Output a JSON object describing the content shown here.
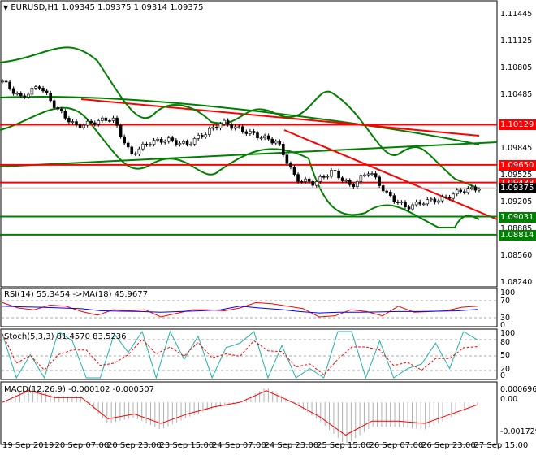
{
  "header": {
    "arrow": "▼",
    "symbol": "EURUSD,H1",
    "ohlc": "1.09345 1.09375 1.09314 1.09375"
  },
  "price_axis": [
    "1.11445",
    "1.11125",
    "1.10805",
    "1.10485",
    "1.09845",
    "1.09525",
    "1.09205",
    "1.08885",
    "1.08560",
    "1.08240"
  ],
  "levels": [
    {
      "value": 1.10129,
      "label": "1.10129",
      "color": "#ff0000"
    },
    {
      "value": 1.0965,
      "label": "1.09650",
      "color": "#ff0000"
    },
    {
      "value": 1.09438,
      "label": "1.09438",
      "color": "#ff0000"
    },
    {
      "value": 1.09375,
      "label": "1.09375",
      "color": "#000000"
    },
    {
      "value": 1.09031,
      "label": "1.09031",
      "color": "#008000"
    },
    {
      "value": 1.08814,
      "label": "1.08814",
      "color": "#008000"
    }
  ],
  "chart_data": {
    "type": "line",
    "closes": [
      1.1065,
      1.1045,
      1.106,
      1.1031,
      1.1011,
      1.1016,
      1.1021,
      1.0977,
      1.0992,
      1.0995,
      1.0989,
      1.1002,
      1.1016,
      1.1007,
      1.0999,
      1.0992,
      1.0948,
      1.0943,
      1.0958,
      1.0939,
      1.0958,
      1.0929,
      1.0914,
      1.0921,
      1.0924,
      1.0934,
      1.09375
    ],
    "ylim": [
      1.0824,
      1.11445
    ]
  },
  "rsi": {
    "label": "RSI(14) 55.3454  ->MA(18) 45.9677",
    "axis": [
      "100",
      "70",
      "30",
      "0"
    ],
    "values": [
      65,
      50,
      45,
      58,
      55,
      40,
      30,
      45,
      42,
      45,
      25,
      35,
      45,
      45,
      42,
      50,
      65,
      62,
      55,
      48,
      25,
      28,
      45,
      40,
      28,
      55,
      38,
      40,
      42,
      52,
      55
    ],
    "ma": [
      55,
      53,
      52,
      50,
      48,
      42,
      41,
      40,
      38,
      40,
      42,
      45,
      55,
      50,
      46,
      40,
      36,
      38,
      38,
      39,
      40,
      40,
      41,
      42,
      46
    ]
  },
  "stoch": {
    "label": "Stoch(5,3,3) 81.4570 83.5236",
    "axis": [
      "100",
      "80",
      "50",
      "20",
      "0"
    ],
    "values": [
      95,
      0,
      50,
      0,
      100,
      80,
      0,
      0,
      95,
      55,
      100,
      0,
      100,
      40,
      90,
      0,
      65,
      75,
      100,
      0,
      70,
      0,
      20,
      0,
      100,
      100,
      0,
      80,
      0,
      20,
      30,
      75,
      20,
      100,
      82
    ]
  },
  "macd": {
    "label": "MACD(12,26,9) -0.000102 -0.000507",
    "axis": [
      "0.000696",
      "0.00",
      "-0.001729"
    ],
    "values": [
      0.0,
      0.0005,
      0.0002,
      0.0002,
      -0.0007,
      -0.0005,
      -0.0009,
      -0.0005,
      -0.0002,
      0.0,
      0.0005,
      0.0,
      -0.0006,
      -0.0014,
      -0.0008,
      -0.0008,
      -0.0009,
      -0.0005,
      -0.0001
    ]
  },
  "time_axis": [
    "19 Sep 2019",
    "20 Sep 07:00",
    "20 Sep 23:00",
    "23 Sep 15:00",
    "24 Sep 07:00",
    "24 Sep 23:00",
    "25 Sep 15:00",
    "26 Sep 07:00",
    "26 Sep 23:00",
    "27 Sep 15:00"
  ]
}
